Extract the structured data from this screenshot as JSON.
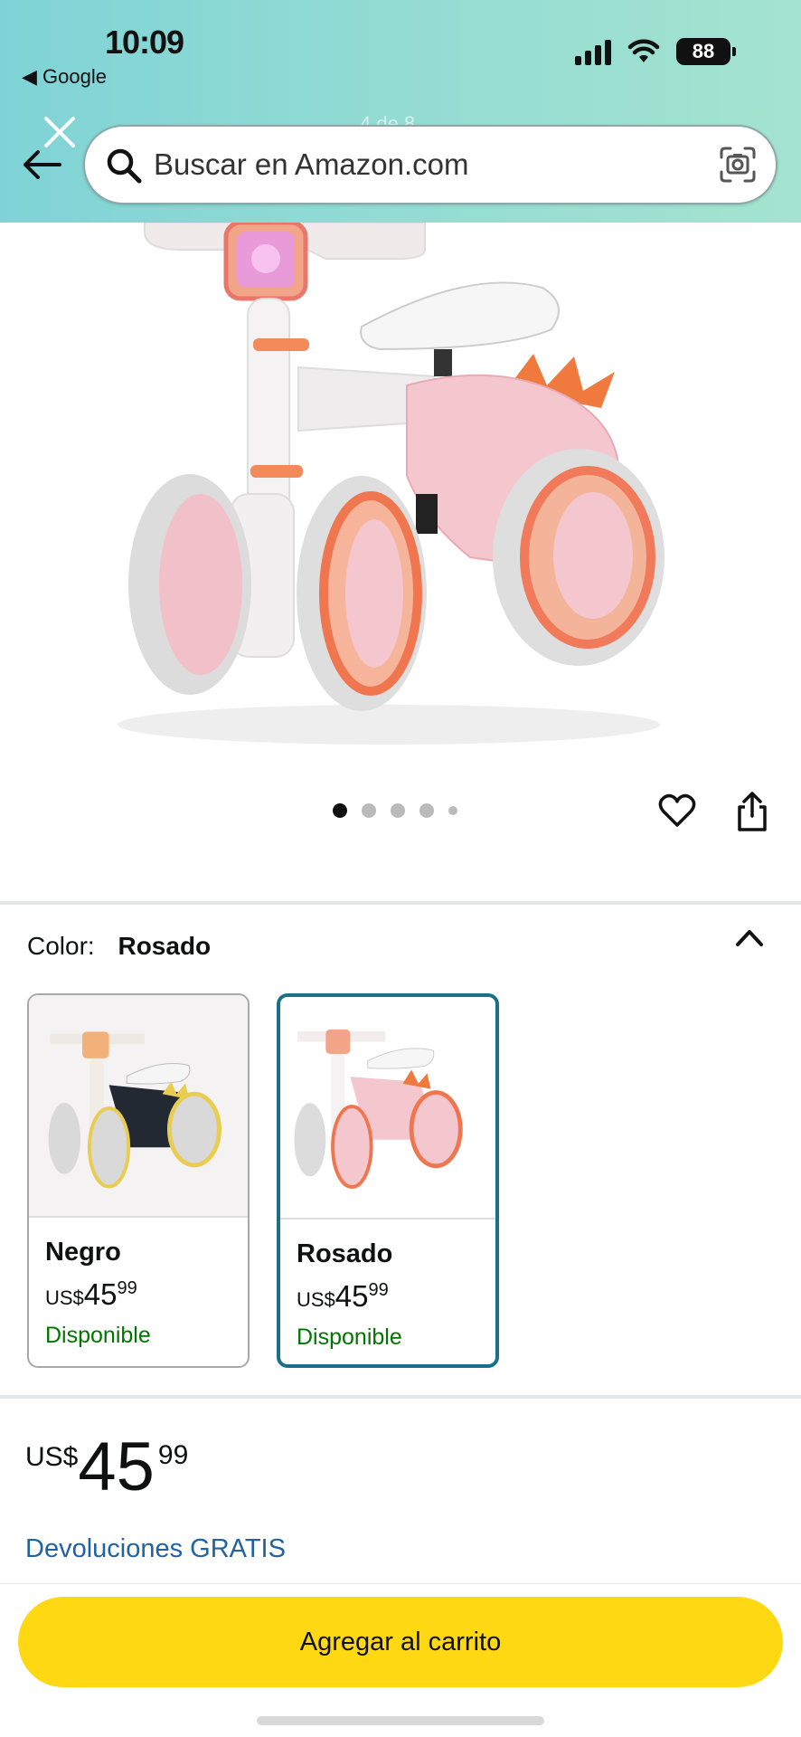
{
  "status_bar": {
    "time": "10:09",
    "back_app": "◀ Google",
    "battery": "88"
  },
  "header": {
    "page_counter": "4 de 8",
    "search_placeholder": "Buscar en Amazon.com"
  },
  "gallery": {
    "dot_count": 5,
    "active_dot": 0
  },
  "color_section": {
    "label": "Color:",
    "selected": "Rosado",
    "options": [
      {
        "name": "Negro",
        "currency": "US$",
        "whole": "45",
        "cents": "99",
        "availability": "Disponible",
        "selected": false
      },
      {
        "name": "Rosado",
        "currency": "US$",
        "whole": "45",
        "cents": "99",
        "availability": "Disponible",
        "selected": true
      }
    ]
  },
  "price": {
    "currency": "US$",
    "whole": "45",
    "cents": "99"
  },
  "returns_link": "Devoluciones GRATIS",
  "cart_button": "Agregar al carrito",
  "colors": {
    "header_gradient_start": "#7fd3d6",
    "header_gradient_end": "#a4e3cf",
    "cart_button": "#ffd814",
    "selected_border": "#187189",
    "availability": "#007600",
    "link": "#2162a1"
  }
}
